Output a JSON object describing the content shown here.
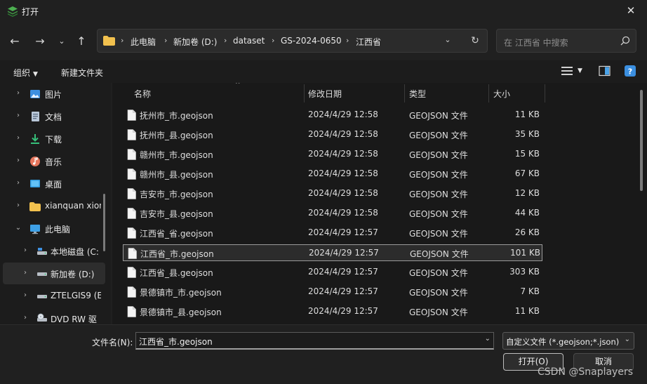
{
  "window": {
    "title": "打开"
  },
  "nav": {
    "breadcrumb": [
      "此电脑",
      "新加卷 (D:)",
      "dataset",
      "GS-2024-0650",
      "江西省"
    ],
    "search_placeholder": "在 江西省 中搜索"
  },
  "toolbar": {
    "organize": "组织",
    "new_folder": "新建文件夹"
  },
  "sidebar": {
    "items": [
      {
        "label": "图片",
        "icon": "pictures-icon"
      },
      {
        "label": "文档",
        "icon": "documents-icon"
      },
      {
        "label": "下载",
        "icon": "downloads-icon"
      },
      {
        "label": "音乐",
        "icon": "music-icon"
      },
      {
        "label": "桌面",
        "icon": "desktop-icon"
      },
      {
        "label": "xianquan xion",
        "icon": "folder-icon"
      },
      {
        "label": "此电脑",
        "icon": "this-pc-icon"
      },
      {
        "label": "本地磁盘 (C:",
        "icon": "drive-icon"
      },
      {
        "label": "新加卷 (D:)",
        "icon": "drive-icon"
      },
      {
        "label": "ZTELGIS9 (E",
        "icon": "drive-icon"
      },
      {
        "label": "DVD RW 驱",
        "icon": "dvd-icon"
      }
    ]
  },
  "columns": {
    "name": "名称",
    "modified": "修改日期",
    "type": "类型",
    "size": "大小"
  },
  "files": [
    {
      "name": "抚州市_市.geojson",
      "modified": "2024/4/29 12:58",
      "type": "GEOJSON 文件",
      "size": "11 KB"
    },
    {
      "name": "抚州市_县.geojson",
      "modified": "2024/4/29 12:58",
      "type": "GEOJSON 文件",
      "size": "35 KB"
    },
    {
      "name": "赣州市_市.geojson",
      "modified": "2024/4/29 12:58",
      "type": "GEOJSON 文件",
      "size": "15 KB"
    },
    {
      "name": "赣州市_县.geojson",
      "modified": "2024/4/29 12:58",
      "type": "GEOJSON 文件",
      "size": "67 KB"
    },
    {
      "name": "吉安市_市.geojson",
      "modified": "2024/4/29 12:58",
      "type": "GEOJSON 文件",
      "size": "12 KB"
    },
    {
      "name": "吉安市_县.geojson",
      "modified": "2024/4/29 12:58",
      "type": "GEOJSON 文件",
      "size": "44 KB"
    },
    {
      "name": "江西省_省.geojson",
      "modified": "2024/4/29 12:57",
      "type": "GEOJSON 文件",
      "size": "26 KB"
    },
    {
      "name": "江西省_市.geojson",
      "modified": "2024/4/29 12:57",
      "type": "GEOJSON 文件",
      "size": "101 KB"
    },
    {
      "name": "江西省_县.geojson",
      "modified": "2024/4/29 12:57",
      "type": "GEOJSON 文件",
      "size": "303 KB"
    },
    {
      "name": "景德镇市_市.geojson",
      "modified": "2024/4/29 12:57",
      "type": "GEOJSON 文件",
      "size": "7 KB"
    },
    {
      "name": "景德镇市_县.geojson",
      "modified": "2024/4/29 12:57",
      "type": "GEOJSON 文件",
      "size": "11 KB"
    }
  ],
  "bottom": {
    "filename_label": "文件名(N):",
    "filename_value": "江西省_市.geojson",
    "filetype_value": "自定义文件 (*.geojson;*.json)",
    "open_label": "打开(O)",
    "cancel_label": "取消"
  },
  "watermark": "CSDN @Snaplayers"
}
